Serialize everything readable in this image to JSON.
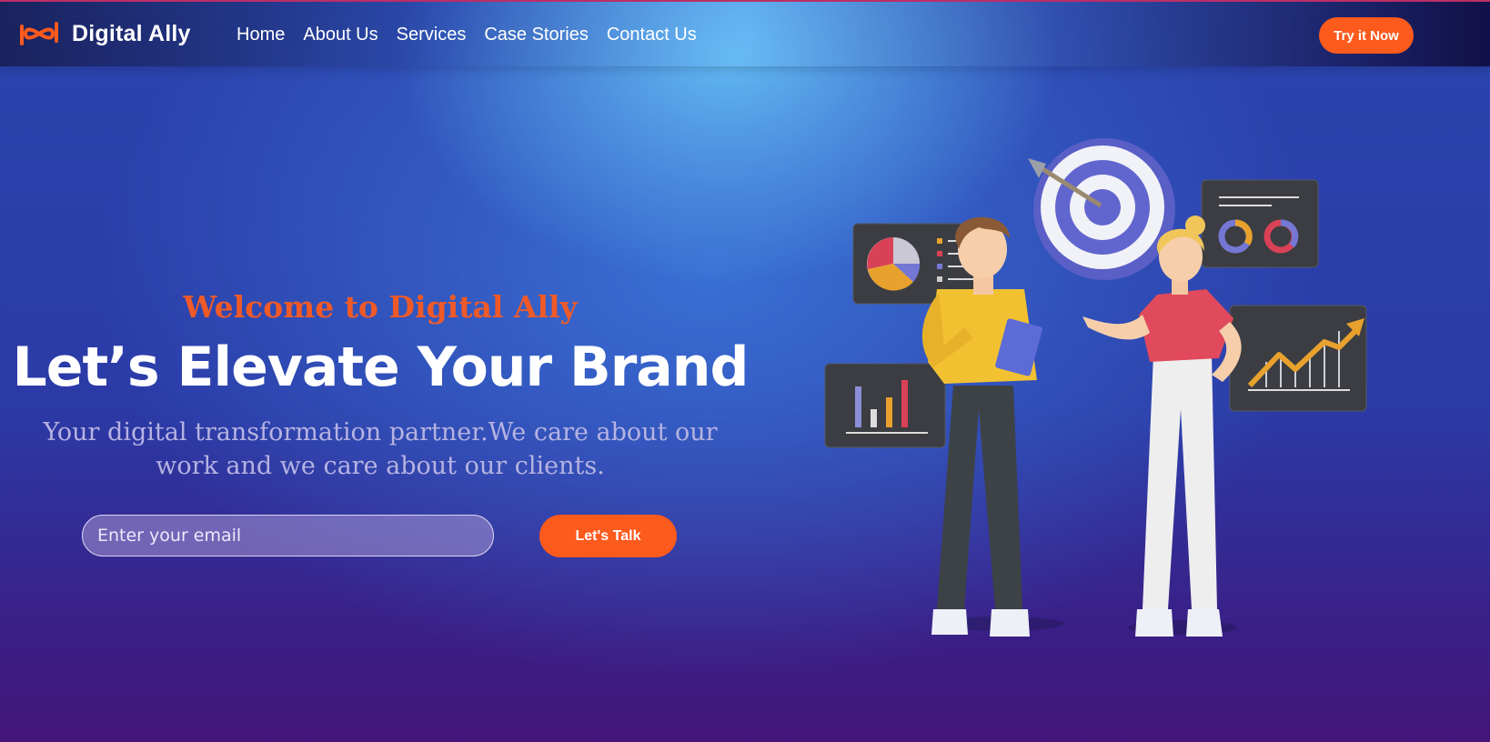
{
  "brand": {
    "name": "Digital Ally",
    "logo_icon": "infinity-logo-icon",
    "accent_color": "#fd5a1e"
  },
  "nav": {
    "items": [
      {
        "label": "Home"
      },
      {
        "label": "About Us"
      },
      {
        "label": "Services"
      },
      {
        "label": "Case Stories"
      },
      {
        "label": "Contact Us"
      }
    ],
    "cta_label": "Try it Now"
  },
  "hero": {
    "welcome": "Welcome to Digital Ally",
    "headline": "Let’s Elevate Your Brand",
    "subtext": "Your digital transformation partner.We care about our work and we care about our clients.",
    "email_placeholder": "Enter your email",
    "email_value": "",
    "cta_label": "Let's Talk"
  },
  "illustration": {
    "icon": "business-team-illustration"
  }
}
